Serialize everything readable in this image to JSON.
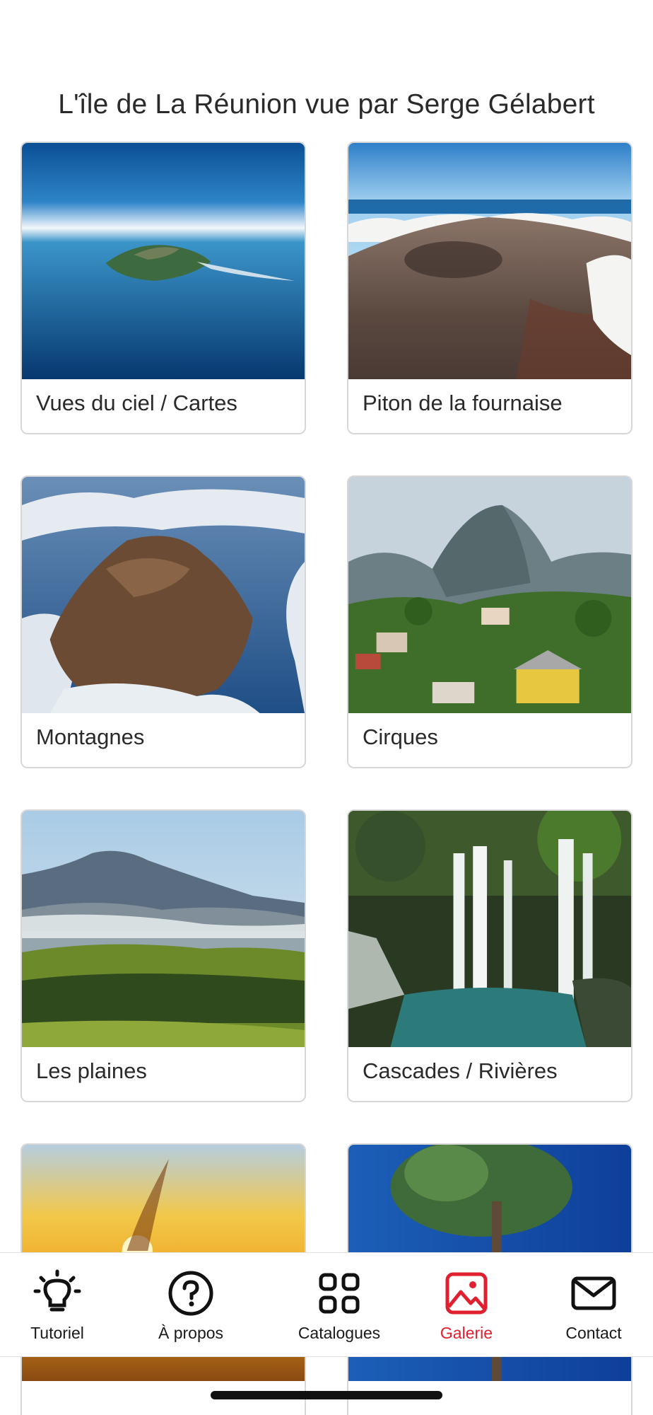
{
  "header": {
    "title": "L'île de La Réunion vue par Serge Gélabert"
  },
  "gallery": {
    "items": [
      {
        "label": "Vues du ciel / Cartes",
        "image": "aerial-island-ocean"
      },
      {
        "label": "Piton de la fournaise",
        "image": "volcano-crater-clouds"
      },
      {
        "label": "Montagnes",
        "image": "rocky-peak-above-clouds"
      },
      {
        "label": "Cirques",
        "image": "village-below-mountain"
      },
      {
        "label": "Les plaines",
        "image": "plains-mountain-range"
      },
      {
        "label": "Cascades / Rivières",
        "image": "waterfalls-pool"
      },
      {
        "label": "",
        "image": "sunset-sparks"
      },
      {
        "label": "",
        "image": "tree-blue-sky"
      }
    ]
  },
  "tabbar": {
    "tabs": [
      {
        "label": "Tutoriel",
        "icon": "lightbulb-icon",
        "active": false
      },
      {
        "label": "À propos",
        "icon": "question-circle-icon",
        "active": false
      },
      {
        "label": "Catalogues",
        "icon": "grid-four-icon",
        "active": false
      },
      {
        "label": "Galerie",
        "icon": "image-icon",
        "active": true
      },
      {
        "label": "Contact",
        "icon": "envelope-icon",
        "active": false
      }
    ]
  },
  "colors": {
    "accent": "#e0202e",
    "text": "#2a2a2a",
    "border": "#d7d7d7"
  }
}
